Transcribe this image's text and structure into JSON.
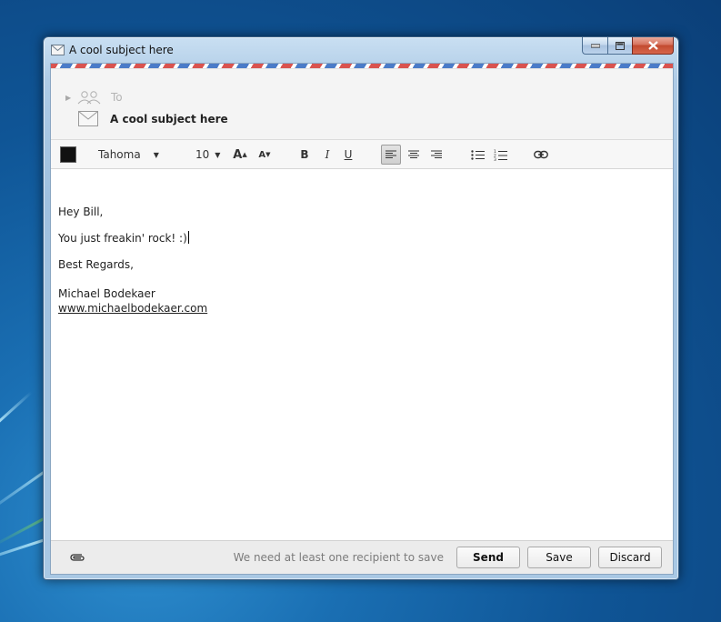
{
  "window": {
    "title": "A cool subject here"
  },
  "header": {
    "to_label": "To",
    "subject": "A cool subject here"
  },
  "toolbar": {
    "text_color": "#111111",
    "font_family": "Tahoma",
    "font_size": "10",
    "grow_label": "A",
    "shrink_label": "A",
    "bold_label": "B",
    "italic_label": "I",
    "underline_label": "U",
    "active_alignment": "left"
  },
  "message": {
    "greeting": "Hey Bill,",
    "line": "You just freakin' rock! :)",
    "closing": "Best Regards,",
    "signature_name": "Michael Bodekaer",
    "signature_url": "www.michaelbodekaer.com"
  },
  "footer": {
    "status": "We need at least one recipient to save",
    "send_label": "Send",
    "save_label": "Save",
    "discard_label": "Discard"
  },
  "icons": [
    "envelope-icon",
    "minimize-icon",
    "maximize-icon",
    "close-icon",
    "expand-triangle-icon",
    "recipients-icon",
    "color-swatch-icon",
    "dropdown-caret-icon",
    "align-left-icon",
    "align-center-icon",
    "align-right-icon",
    "bulleted-list-icon",
    "numbered-list-icon",
    "link-icon",
    "paperclip-icon"
  ]
}
